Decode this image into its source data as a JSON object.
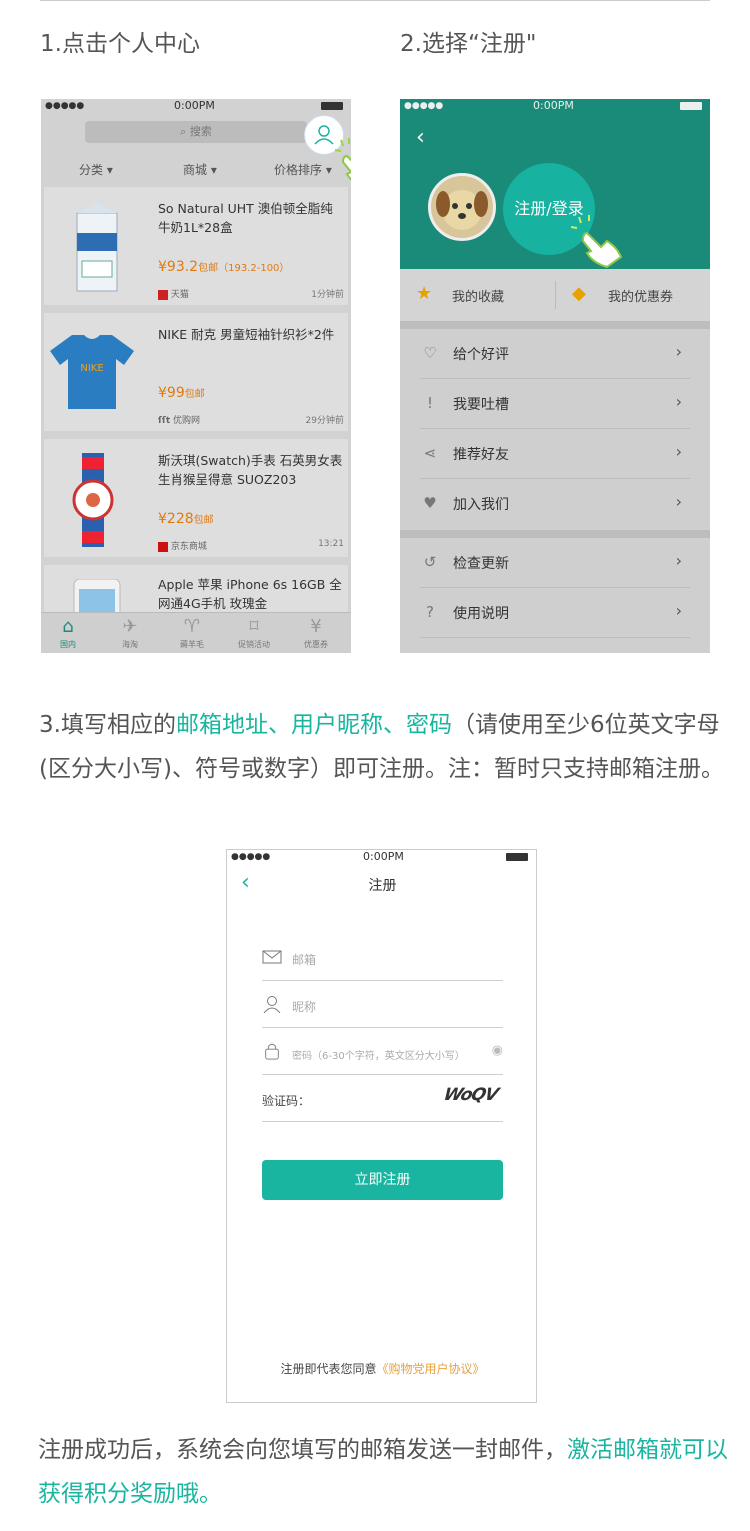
{
  "step1": {
    "title": "1.点击个人中心"
  },
  "step2": {
    "title": "2.选择“注册\""
  },
  "phone1": {
    "status_time": "0:00PM",
    "signal": "●●●●●",
    "search_placeholder": "搜索",
    "filters": [
      "分类 ▾",
      "商城 ▾",
      "价格排序 ▾"
    ],
    "products": [
      {
        "title": "So Natural UHT 澳伯顿全脂纯牛奶1L*28盒",
        "price": "¥93.2",
        "price_suffix": "包邮（193.2-100）",
        "source": "天猫",
        "time": "1分钟前"
      },
      {
        "title": "NIKE 耐克 男童短袖针织衫*2件",
        "price": "¥99",
        "price_suffix": "包邮",
        "source": "优购网",
        "time": "29分钟前"
      },
      {
        "title": "斯沃琪(Swatch)手表 石英男女表生肖猴呈得意 SUOZ203",
        "price": "¥228",
        "price_suffix": "包邮",
        "source": "京东商城",
        "time": "13:21"
      },
      {
        "title": "Apple 苹果 iPhone 6s 16GB 全网通4G手机 玫瑰金",
        "price": "",
        "price_suffix": "",
        "source": "",
        "time": ""
      }
    ],
    "tabs": [
      "国内",
      "海淘",
      "薅羊毛",
      "促销活动",
      "优惠券"
    ]
  },
  "phone2": {
    "status_time": "0:00PM",
    "signal": "●●●●●",
    "register_login": "注册/登录",
    "favorites": "我的收藏",
    "coupons": "我的优惠券",
    "rows": [
      "给个好评",
      "我要吐槽",
      "推荐好友",
      "加入我们",
      "检查更新",
      "使用说明"
    ]
  },
  "step3": {
    "prefix": "3.填写相应的",
    "highlight": "邮箱地址、用户昵称、密码",
    "suffix": "（请使用至少6位英文字母(区分大小写)、符号或数字）即可注册。注：暂时只支持邮箱注册。"
  },
  "phone3": {
    "status_time": "0:00PM",
    "signal": "●●●●●",
    "title": "注册",
    "email_placeholder": "邮箱",
    "nickname_placeholder": "昵称",
    "password_placeholder": "密码（6-30个字符，英文区分大小写）",
    "captcha_label": "验证码：",
    "captcha_image": "WoQV",
    "submit": "立即注册",
    "agree_prefix": "注册即代表您同意",
    "agree_link": "《购物党用户协议》"
  },
  "final": {
    "prefix": "注册成功后，系统会向您填写的邮箱发送一封邮件，",
    "highlight": "激活邮箱就可以获得积分奖励哦。"
  },
  "colors": {
    "accent": "#19b5a0",
    "header_green": "#1a8b79",
    "price_orange": "#e07a10"
  }
}
